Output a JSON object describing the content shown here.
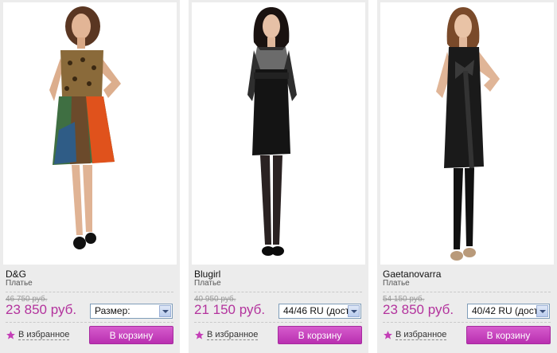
{
  "products": [
    {
      "brand": "D&G",
      "type": "Платье",
      "old_price": "46 750 руб.",
      "price": "23 850 руб.",
      "size": "Размер:",
      "fav_label": "В избранное",
      "cart_label": "В корзину"
    },
    {
      "brand": "Blugirl",
      "type": "Платье",
      "old_price": "40 950 руб.",
      "price": "21 150 руб.",
      "size": "44/46 RU (дост",
      "fav_label": "В избранное",
      "cart_label": "В корзину"
    },
    {
      "brand": "Gaetanovarra",
      "type": "Платье",
      "old_price": "54 150 руб.",
      "price": "23 850 руб.",
      "size": "40/42 RU (дост",
      "fav_label": "В избранное",
      "cart_label": "В корзину"
    }
  ],
  "colors": {
    "accent": "#b3339d",
    "button": "#c642bd",
    "card_bg": "#ececec"
  },
  "icons": {
    "favorite": "star-icon",
    "dropdown": "chevron-down-icon"
  }
}
